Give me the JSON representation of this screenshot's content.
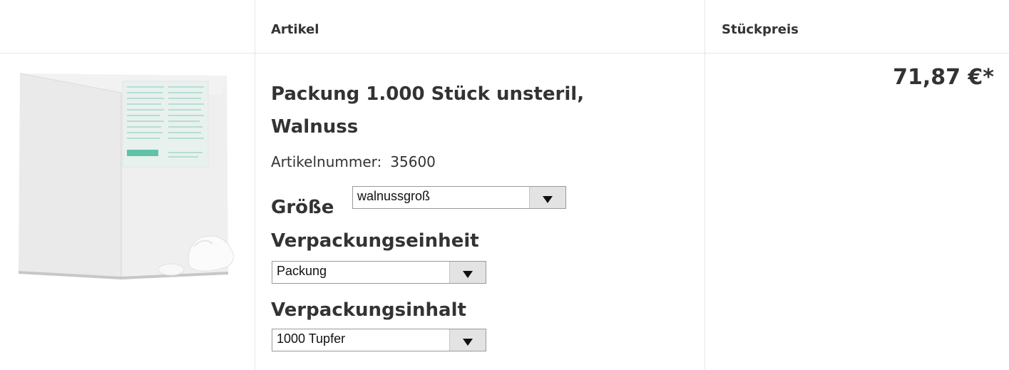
{
  "table": {
    "header": {
      "article_col": "Artikel",
      "price_col": "Stückpreis"
    },
    "row": {
      "image_icon": "product-box-image",
      "title": "Packung 1.000 Stück unsteril, Walnuss",
      "article_number_label": "Artikelnummer:",
      "article_number_value": "35600",
      "price": "71,87 €*",
      "options": {
        "size": {
          "label": "Größe",
          "selected": "walnussgroß"
        },
        "packaging_unit": {
          "label": "Verpackungseinheit",
          "selected": "Packung"
        },
        "packaging_content": {
          "label": "Verpackungsinhalt",
          "selected": "1000 Tupfer"
        }
      }
    }
  },
  "colors": {
    "text": "#333333",
    "border": "#e6e6e6",
    "select_border": "#9a9a9a",
    "arrow_bg": "#e3e3e3"
  }
}
